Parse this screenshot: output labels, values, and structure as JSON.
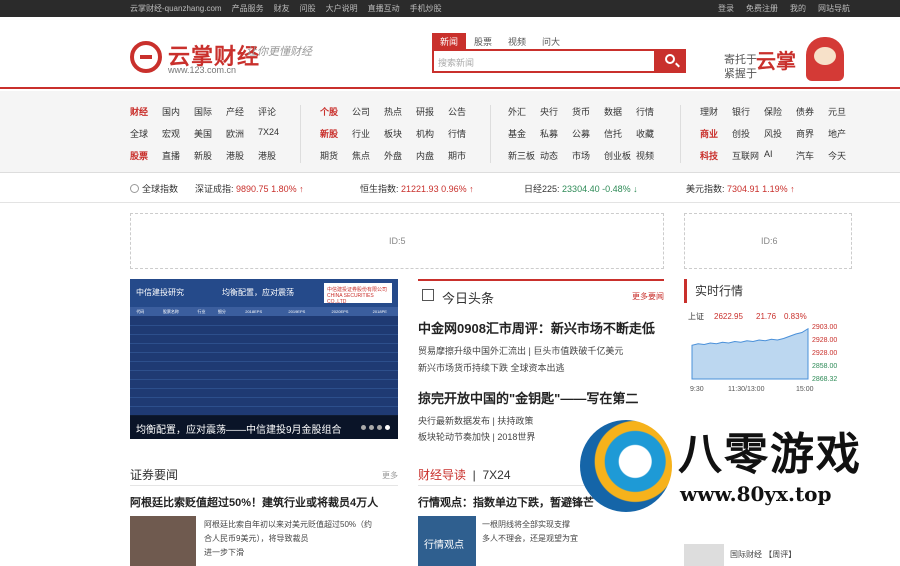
{
  "topbar": {
    "site": "云掌财经-quanzhang.com",
    "links": [
      "产品服务",
      "财友",
      "问股",
      "大户说明",
      "直播互动",
      "手机炒股"
    ],
    "right_links": [
      "登录",
      "免费注册",
      "我的",
      "网站导航"
    ]
  },
  "header": {
    "logo_text": "云掌财经",
    "logo_url": "www.123.com.cn",
    "slogan": "让你更懂财经",
    "search_tabs": [
      "新闻",
      "股票",
      "视频",
      "问大"
    ],
    "search_placeholder": "搜索新闻",
    "promo_line1": "寄托于",
    "promo_line2": "紧握于",
    "promo_big": "云掌"
  },
  "nav": {
    "group1": [
      "财经",
      "国内",
      "国际",
      "产经",
      "评论",
      "全球",
      "宏观",
      "美国",
      "欧洲",
      "7X24",
      "股票",
      "直播",
      "新股",
      "港股",
      "港股"
    ],
    "group2": [
      "个股",
      "公司",
      "热点",
      "研报",
      "公告",
      "新股",
      "行业",
      "板块",
      "机构",
      "行情",
      "期货",
      "焦点",
      "外盘",
      "内盘",
      "期市"
    ],
    "group3": [
      "外汇",
      "央行",
      "货币",
      "数据",
      "行情",
      "基金",
      "私募",
      "公募",
      "信托",
      "收藏",
      "新三板",
      "动态",
      "市场",
      "创业板",
      "视频"
    ],
    "group4": [
      "理财",
      "银行",
      "保险",
      "债券",
      "元旦",
      "商业",
      "创投",
      "风投",
      "商界",
      "地产",
      "科技",
      "互联网",
      "AI",
      "汽车",
      "今天"
    ]
  },
  "ticker": {
    "label": "全球指数",
    "items": [
      {
        "name": "深证成指:",
        "value": "9890.75",
        "change": "1.80%",
        "dir": "up"
      },
      {
        "name": "恒生指数:",
        "value": "21221.93",
        "change": "0.96%",
        "dir": "up"
      },
      {
        "name": "日经225:",
        "value": "23304.40",
        "change": "-0.48%",
        "dir": "down"
      },
      {
        "name": "美元指数:",
        "value": "7304.91",
        "change": "1.19%",
        "dir": "up"
      }
    ]
  },
  "ads": {
    "left": "ID:5",
    "right": "ID:6"
  },
  "slideshow": {
    "header": "中信建投研究",
    "header_mid": "均衡配置，应对震荡",
    "badge": "中信建投证券股份有限公司 CHINA SECURITIES CO.,LTD",
    "columns": [
      "代码",
      "股票名称",
      "行业",
      "细分",
      "2018EPS",
      "2019EPS",
      "2020EPS",
      "2018PE"
    ],
    "caption": "均衡配置，应对震荡——中信建投9月金股组合"
  },
  "headlines": {
    "section_title": "今日头条",
    "more": "更多要闻",
    "items": [
      {
        "title": "中金网0908汇市周评：新兴市场不断走低",
        "subs": [
          "贸易摩擦升级中国外汇流出",
          "巨头市值跌破千亿美元"
        ]
      },
      {
        "title": "掠完开放中国的\"金钥匙\"——写在第二",
        "subs": [
          "央行最新数据发布",
          "扶持政策",
          "2018世界"
        ]
      }
    ],
    "extra_subs": [
      "新兴市场货币持续下跌 全球资本出逃",
      "板块轮动节奏加快"
    ]
  },
  "market": {
    "title": "实时行情",
    "tab": "上证",
    "numbers": [
      "2622.95",
      "21.76",
      "0.83%"
    ],
    "y_labels": [
      "2903.00",
      "2928.00",
      "2928.00",
      "2858.00",
      "2868.32"
    ],
    "x_labels": [
      "9:30",
      "11:30/13:00",
      "15:00"
    ]
  },
  "chart_data": {
    "type": "area",
    "x": [
      "9:30",
      "11:30/13:00",
      "15:00"
    ],
    "values": [
      2903,
      2905,
      2904,
      2906,
      2905,
      2907,
      2906,
      2908,
      2907,
      2909,
      2908,
      2910,
      2909,
      2911,
      2910,
      2912,
      2915,
      2918,
      2920,
      2925
    ],
    "ylim": [
      2858,
      2930
    ]
  },
  "bottom_left": {
    "title": "证券要闻",
    "more": "更多",
    "headline": "阿根廷比索贬值超过50%！建筑行业或将裁员4万人",
    "blurb": [
      "阿根廷比索自年初以来对美元贬值超过50%（约",
      "合人民币9美元），将导致裁员",
      "进一步下滑"
    ]
  },
  "bottom_mid": {
    "tabs": [
      "财经导读",
      "7X24"
    ],
    "headline": "行情观点：指数单边下跌，暂避锋芒",
    "blurb": [
      "一根阴线将全部实现支撑",
      "多人不理会，还是观望为宜"
    ],
    "thumb_text": "行情观点"
  },
  "bottom_right": {
    "blurb": "国际财经 【周评】"
  },
  "watermark": {
    "text": "八零游戏",
    "url": "www.80yx.top"
  }
}
